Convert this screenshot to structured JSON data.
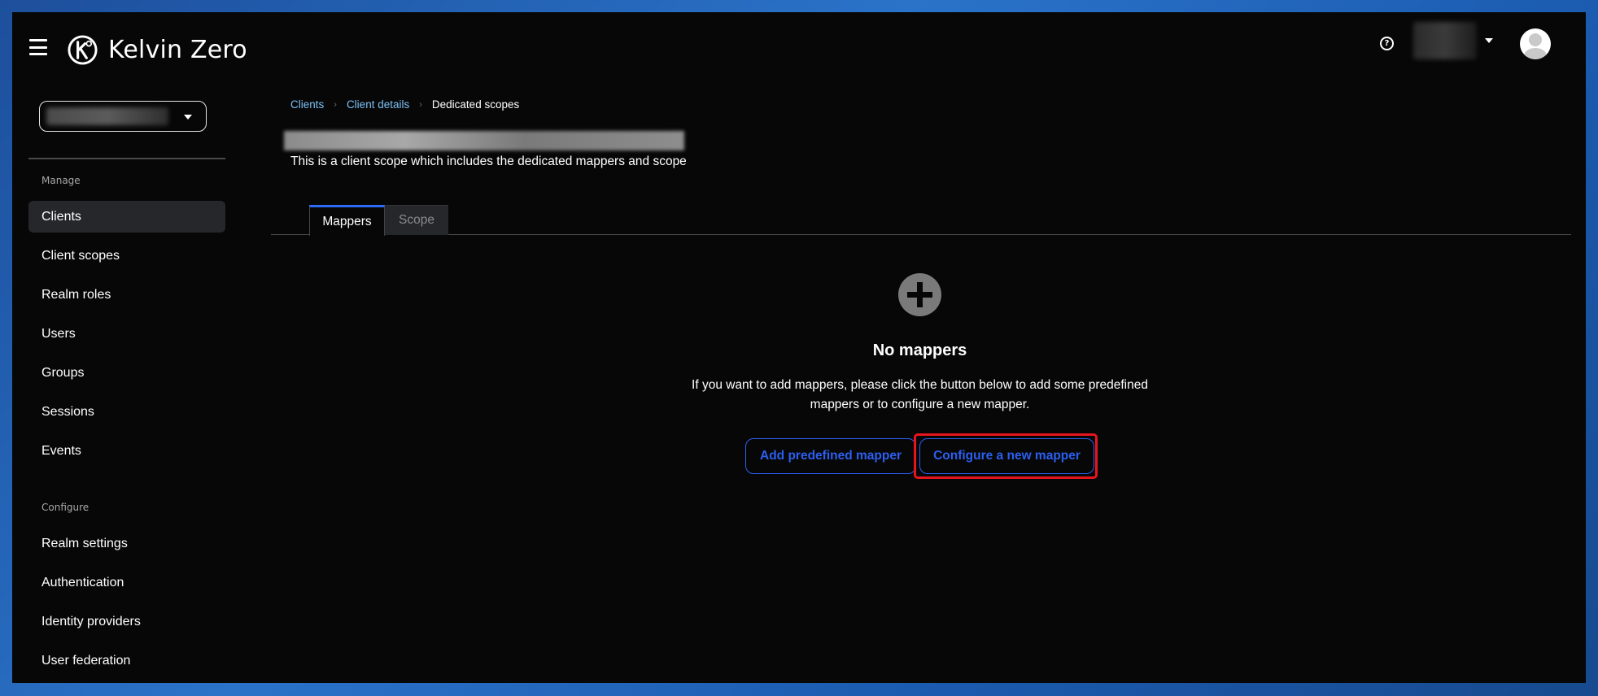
{
  "header": {
    "brand": "Kelvin Zero",
    "help_icon": "question-circle-icon",
    "user_menu_icon": "caret-down-icon",
    "avatar_icon": "user-avatar-icon"
  },
  "sidebar": {
    "realm_selector_icon": "caret-down-icon",
    "sections": [
      {
        "title": "Manage",
        "items": [
          {
            "label": "Clients",
            "active": true
          },
          {
            "label": "Client scopes"
          },
          {
            "label": "Realm roles"
          },
          {
            "label": "Users"
          },
          {
            "label": "Groups"
          },
          {
            "label": "Sessions"
          },
          {
            "label": "Events"
          }
        ]
      },
      {
        "title": "Configure",
        "items": [
          {
            "label": "Realm settings"
          },
          {
            "label": "Authentication"
          },
          {
            "label": "Identity providers"
          },
          {
            "label": "User federation"
          }
        ]
      }
    ]
  },
  "breadcrumb": {
    "items": [
      "Clients",
      "Client details",
      "Dedicated scopes"
    ],
    "separator": "›"
  },
  "page": {
    "subtitle": "This is a client scope which includes the dedicated mappers and scope"
  },
  "tabs": {
    "mappers": "Mappers",
    "scope": "Scope"
  },
  "empty_state": {
    "icon": "plus-circle-icon",
    "title": "No mappers",
    "body": "If you want to add mappers, please click the button below to add some predefined mappers or to configure a new mapper.",
    "add_predefined_label": "Add predefined mapper",
    "configure_new_label": "Configure a new mapper"
  },
  "colors": {
    "accent": "#2b5ff0",
    "highlight": "#e8141d",
    "link": "#7cc0f5",
    "background": "#070707"
  }
}
